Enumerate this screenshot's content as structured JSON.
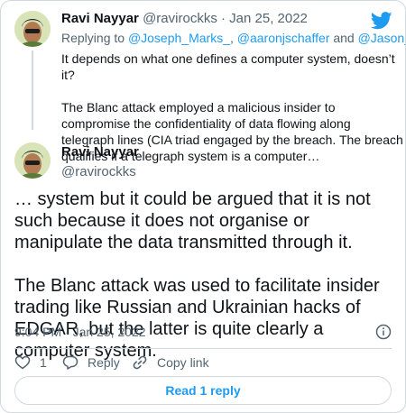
{
  "parent_tweet": {
    "author_name": "Ravi Nayyar",
    "author_handle": "@ravirockks",
    "separator": "·",
    "date": "Jan 25, 2022",
    "replying_prefix": "Replying to",
    "replying_to": [
      "@Joseph_Marks_",
      "@aaronjschaffer",
      "@Jason_Healey"
    ],
    "replying_joiner_and": "and",
    "paragraphs": [
      "It depends on what one defines a computer system, doesn’t it?",
      "The Blanc attack employed a malicious insider to compromise the confidentiality of data flowing along telegraph lines (CIA triad engaged by the breach. The breach qualifies if a telegraph system is a computer…"
    ]
  },
  "main_tweet": {
    "author_name": "Ravi Nayyar",
    "author_handle": "@ravirockks",
    "paragraphs": [
      "… system but it could be argued that it is not such because it does not organise or manipulate the data transmitted through it.",
      "The Blanc attack was used to facilitate insider trading like Russian and Ukrainian hacks of EDGAR, but the latter is quite clearly a computer system."
    ],
    "timestamp": "9:04 PM · Jan 25, 2022"
  },
  "actions": {
    "like_count": "1",
    "reply_label": "Reply",
    "copy_link_label": "Copy link"
  },
  "read_reply_label": "Read 1 reply",
  "colors": {
    "brand": "#1d9bf0",
    "text": "#0f1419",
    "muted": "#536471",
    "border": "#cfd9de"
  },
  "icons": [
    "twitter-bird-icon",
    "info-icon",
    "heart-icon",
    "speech-bubble-icon",
    "link-icon"
  ]
}
